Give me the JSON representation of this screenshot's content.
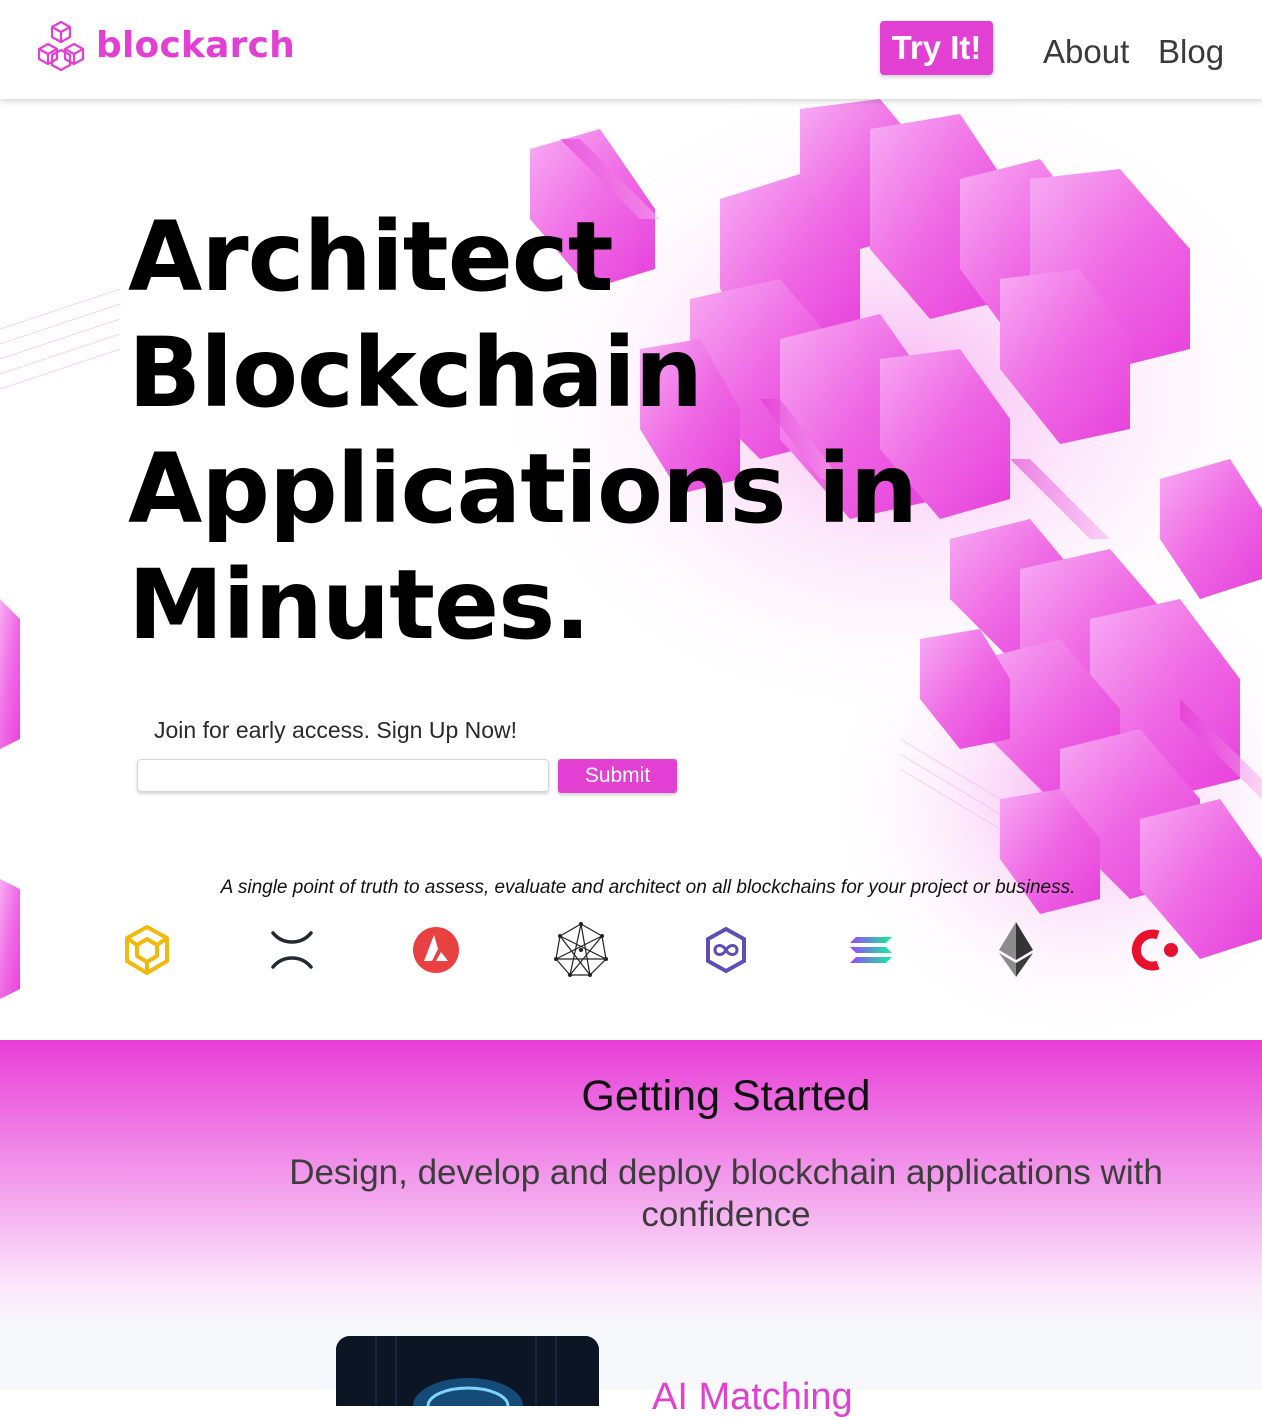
{
  "brand": {
    "name": "blockarch",
    "logo_icon": "cubes-logo-icon",
    "accent": "#e23fd3"
  },
  "nav": {
    "try_label": "Try It!",
    "about_label": "About",
    "blog_label": "Blog"
  },
  "hero": {
    "title_lines": [
      "Architect",
      "Blockchain",
      "Applications in",
      "Minutes."
    ],
    "signup_label": "Join for early access. Sign Up Now!",
    "email_placeholder": "",
    "submit_label": "Submit",
    "tagline": "A single point of truth to assess, evaluate and architect on all blockchains for your project or business.",
    "chains": [
      {
        "icon": "bnb-icon",
        "color": "#f0b90b"
      },
      {
        "icon": "xrp-icon",
        "color": "#23292f"
      },
      {
        "icon": "avalanche-icon",
        "color": "#e84142"
      },
      {
        "icon": "hedera-icon",
        "color": "#222222"
      },
      {
        "icon": "polygon-icon",
        "color": "#5a4fb5"
      },
      {
        "icon": "solana-icon",
        "color": "#9945ff"
      },
      {
        "icon": "ethereum-icon",
        "color": "#343434"
      },
      {
        "icon": "cardano-icon",
        "color": "#e8112d"
      }
    ]
  },
  "getting_started": {
    "title": "Getting Started",
    "subtitle": "Design, develop and deploy blockchain applications with confidence",
    "card_title": "AI Matching"
  }
}
